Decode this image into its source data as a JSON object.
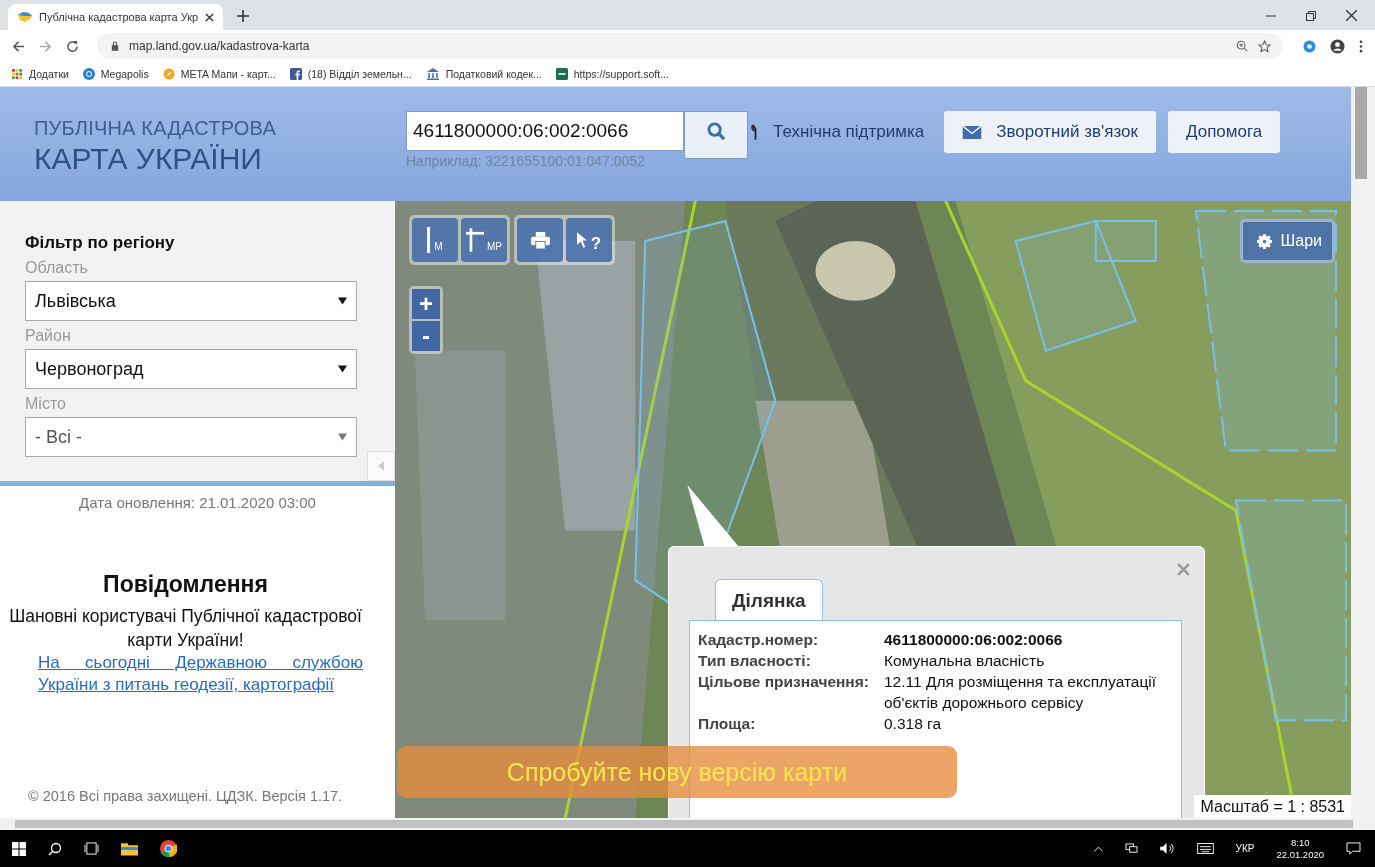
{
  "browser": {
    "tab_title": "Публічна кадастрова карта Укр",
    "url": "map.land.gov.ua/kadastrova-karta",
    "bookmarks": [
      {
        "kind": "apps",
        "label": "Додатки"
      },
      {
        "kind": "globe",
        "label": "Megapolis"
      },
      {
        "kind": "compass",
        "label": "META Мапи - карт..."
      },
      {
        "kind": "facebook",
        "label": "(18) Відділ земельн..."
      },
      {
        "kind": "building",
        "label": "Податковий кодек..."
      },
      {
        "kind": "crm",
        "label": "https://support.soft..."
      }
    ]
  },
  "header": {
    "title_line1": "ПУБЛІЧНА КАДАСТРОВА",
    "title_line2": "КАРТА УКРАЇНИ",
    "search": {
      "value": "4611800000:06:002:0066",
      "hint": "Наприклад: 3221655100:01:047:0052"
    },
    "support_link": "Технічна підтримка",
    "buttons": [
      {
        "kind": "mail",
        "label": "Зворотний зв'язок"
      },
      {
        "kind": "plain",
        "label": "Допомога"
      }
    ]
  },
  "sidebar": {
    "heading": "Фільтр по регіону",
    "filters": [
      {
        "label": "Область",
        "value": "Львівська",
        "disabled": false
      },
      {
        "label": "Район",
        "value": "Червоноград",
        "disabled": false
      },
      {
        "label": "Місто",
        "value": "- Всі -",
        "disabled": true
      }
    ],
    "updated": "Дата оновлення: 21.01.2020 03:00",
    "notice": {
      "title": "Повідомлення",
      "greeting": "Шановні користувачі Публічної кадастрової карти України!",
      "link_text": "На сьогодні Державною службою України з питань геодезії, картографії"
    },
    "footer": "© 2016 Всі права захищені. ЦДЗК. Версія 1.17."
  },
  "map": {
    "tools": [
      {
        "kind": "ruler",
        "label": "М"
      },
      {
        "kind": "area",
        "label": "МР"
      },
      {
        "kind": "print"
      },
      {
        "kind": "identify",
        "label": "?"
      }
    ],
    "zoom": [
      "+",
      "-"
    ],
    "layers_button": "Шари",
    "popup": {
      "tabs": [
        {
          "label": "Ділянка",
          "selected": true
        }
      ],
      "rows": [
        {
          "label": "Кадастр.номер:",
          "value": "4611800000:06:002:0066",
          "bold": true
        },
        {
          "label": "Тип власності:",
          "value": "Комунальна власність",
          "bold": false
        },
        {
          "label": "Цільове призначення:",
          "value": "12.11 Для розміщення та експлуатації об'єктів дорожнього сервісу",
          "bold": false
        },
        {
          "label": "Площа:",
          "value": "0.318 га",
          "bold": false
        }
      ]
    },
    "banner": "Спробуйте нову версію карти",
    "scale": "Масштаб = 1 : 8531"
  },
  "taskbar": {
    "language": "УКР",
    "time": "8:10",
    "date": "22.01.2020"
  }
}
